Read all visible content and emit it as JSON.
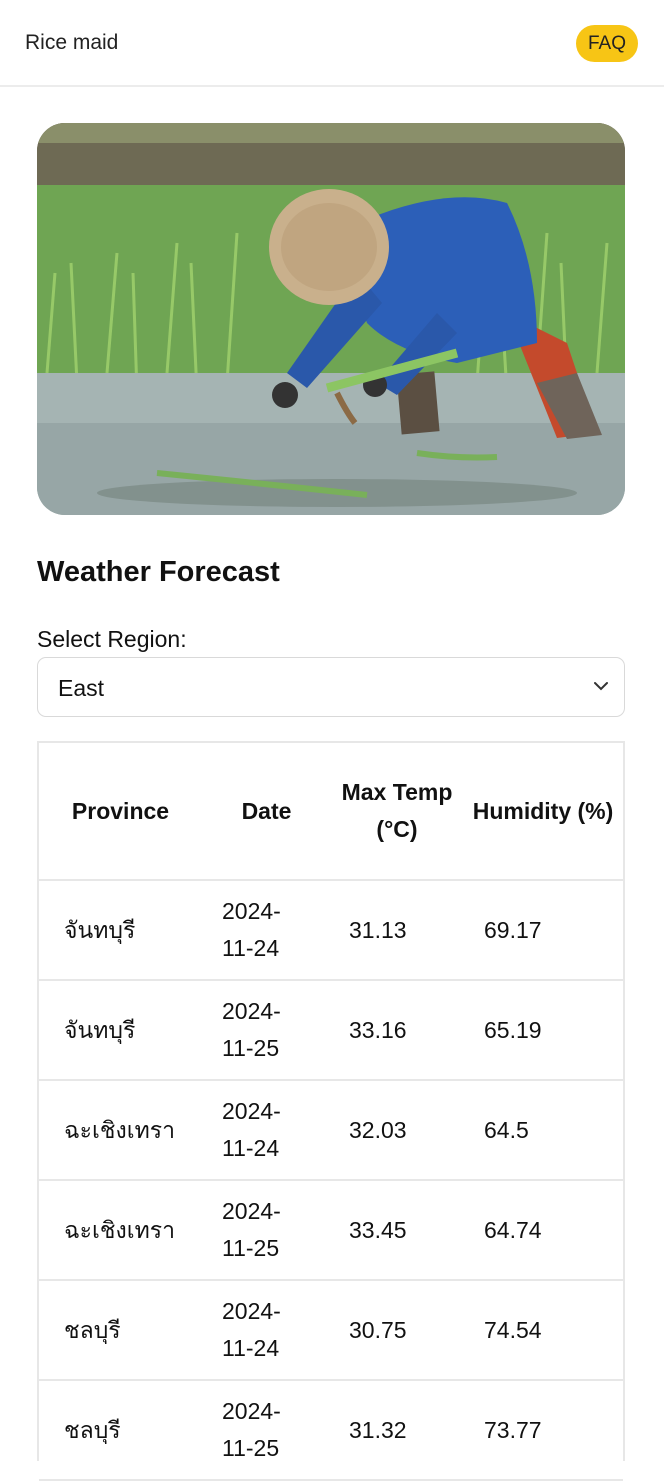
{
  "app": {
    "title": "Rice maid"
  },
  "header": {
    "faq_label": "FAQ"
  },
  "hero": {
    "alt": "Farmer planting rice seedlings in a flooded paddy field"
  },
  "weather": {
    "title": "Weather Forecast",
    "select_label": "Select Region:",
    "selected_region": "East",
    "columns": [
      "Province",
      "Date",
      "Max Temp (°C)",
      "Humidity (%)"
    ],
    "rows": [
      {
        "province": "จันทบุรี",
        "date": "2024-11-24",
        "max_temp": "31.13",
        "humidity": "69.17"
      },
      {
        "province": "จันทบุรี",
        "date": "2024-11-25",
        "max_temp": "33.16",
        "humidity": "65.19"
      },
      {
        "province": "ฉะเชิงเทรา",
        "date": "2024-11-24",
        "max_temp": "32.03",
        "humidity": "64.5"
      },
      {
        "province": "ฉะเชิงเทรา",
        "date": "2024-11-25",
        "max_temp": "33.45",
        "humidity": "64.74"
      },
      {
        "province": "ชลบุรี",
        "date": "2024-11-24",
        "max_temp": "30.75",
        "humidity": "74.54"
      },
      {
        "province": "ชลบุรี",
        "date": "2024-11-25",
        "max_temp": "31.32",
        "humidity": "73.77"
      }
    ]
  }
}
